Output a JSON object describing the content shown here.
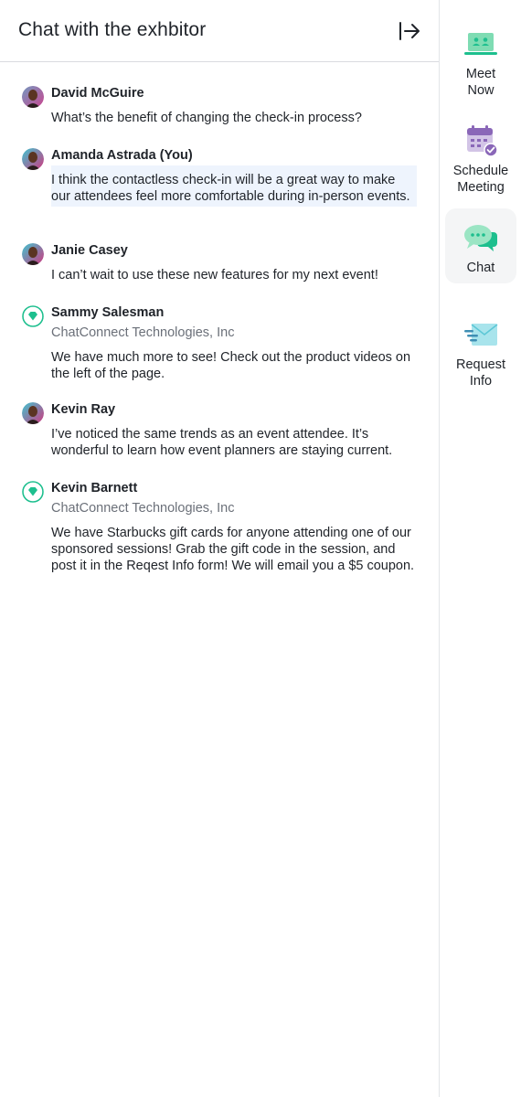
{
  "panel": {
    "title": "Chat with the exhbitor",
    "collapse_icon": "collapse-right-icon"
  },
  "messages": [
    {
      "name": "David McGuire",
      "company": null,
      "text": "What’s the benefit of changing the check-in process?",
      "avatar": "person-avatar"
    },
    {
      "name": "Amanda Astrada (You)",
      "company": null,
      "text": "I think the contactless check-in will be a great way to make our attendees feel more comfortable during in-person events.",
      "avatar": "person-avatar",
      "highlight": true
    },
    {
      "name": "Janie Casey",
      "company": null,
      "text": "I can’t wait to use these new features for my next event!",
      "avatar": "person-avatar"
    },
    {
      "name": "Sammy Salesman",
      "company": "ChatConnect Technologies, Inc",
      "text": "We have much more to see! Check out the product videos on the left of the page.",
      "avatar": "exhibitor-badge-icon"
    },
    {
      "name": "Kevin Ray",
      "company": null,
      "text": "I’ve noticed the same trends as an event attendee.  It’s wonderful to learn how event planners are staying current.",
      "avatar": "person-avatar"
    },
    {
      "name": "Kevin Barnett",
      "company": "ChatConnect Technologies, Inc",
      "text": "We have Starbucks gift cards for anyone attending one of our sponsored sessions! Grab the gift code in the session, and post it in the Reqest Info form! We will email you a $5 coupon.",
      "avatar": "exhibitor-badge-icon"
    }
  ],
  "sidebar": {
    "items": [
      {
        "label_line1": "Meet",
        "label_line2": "Now",
        "icon": "video-meeting-icon"
      },
      {
        "label_line1": "Schedule",
        "label_line2": "Meeting",
        "icon": "calendar-check-icon"
      },
      {
        "label_line1": "Chat",
        "label_line2": "",
        "icon": "chat-bubbles-icon",
        "active": true
      },
      {
        "label_line1": "Request",
        "label_line2": "Info",
        "icon": "envelope-send-icon"
      }
    ]
  },
  "colors": {
    "accent_green": "#1dbf8e",
    "highlight_bg": "#eef4fd",
    "calendar_purple": "#8a67b8",
    "mail_teal": "#5cc7d6"
  }
}
